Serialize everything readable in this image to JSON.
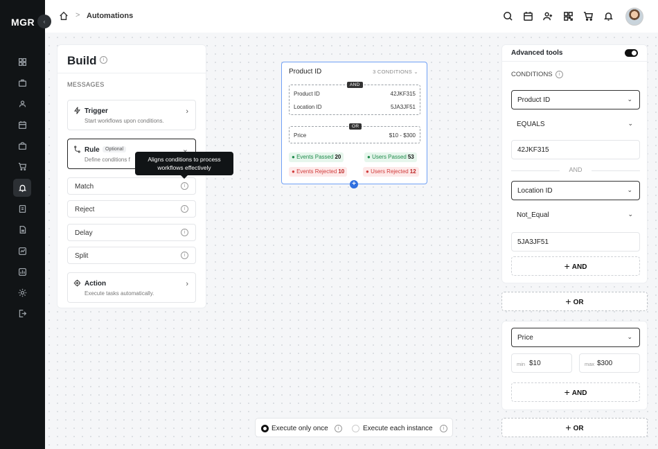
{
  "sidebar": {
    "logo": "MGR",
    "collapse_icon": "chevron-left-icon",
    "items": [
      "grid-icon",
      "briefcase-icon",
      "users-icon",
      "calendar-icon",
      "bag-icon",
      "cart-icon",
      "bell-icon",
      "file-icon",
      "document-icon",
      "chart-icon",
      "bar-chart-icon",
      "settings-icon",
      "logout-icon"
    ],
    "active_index": 6
  },
  "header": {
    "breadcrumb_separator": ">",
    "title": "Automations",
    "icons": [
      "search-icon",
      "calendar-icon",
      "user-plus-icon",
      "qr-icon",
      "cart-icon",
      "bell-icon"
    ]
  },
  "build": {
    "title": "Build",
    "section_label": "MESSAGES",
    "trigger": {
      "title": "Trigger",
      "subtitle": "Start workflows upon conditions."
    },
    "rule": {
      "title": "Rule",
      "badge": "Optional",
      "subtitle": "Define conditions f"
    },
    "tooltip": "Aligns conditions to process workflows effectively",
    "simple_items": [
      "Match",
      "Reject",
      "Delay",
      "Split"
    ],
    "action": {
      "title": "Action",
      "subtitle": "Execute tasks automatically."
    }
  },
  "node": {
    "title": "Product ID",
    "count": "3 CONDITIONS",
    "group1_op": "AND",
    "group1": [
      {
        "label": "Product ID",
        "value": "42JKF315"
      },
      {
        "label": "Location ID",
        "value": "5JA3JF51"
      }
    ],
    "group2_op": "OR",
    "group2": [
      {
        "label": "Price",
        "value": "$10 - $300"
      }
    ],
    "stats": {
      "events_passed_label": "Events Passed",
      "events_passed": "20",
      "users_passed_label": "Users Passed",
      "users_passed": "53",
      "events_rejected_label": "Events Rejected",
      "events_rejected": "10",
      "users_rejected_label": "Users Rejected",
      "users_rejected": "12"
    },
    "add_symbol": "+"
  },
  "execute": {
    "once_label": "Execute only once",
    "each_label": "Execute each instance",
    "selected": "once"
  },
  "advanced": {
    "title": "Advanced tools",
    "toggle_on": true,
    "conditions_label": "CONDITIONS",
    "field1": "Product ID",
    "op1": "EQUALS",
    "value1": "42JKF315",
    "and_sep": "AND",
    "field2": "Location ID",
    "op2": "Not_Equal",
    "value2": "5JA3JF51",
    "add_and": "AND",
    "or_label": "OR",
    "field3": "Price",
    "min_placeholder": "min",
    "min_value": "$10",
    "max_placeholder": "max",
    "max_value": "$300",
    "add_and2": "AND",
    "or_label2": "OR"
  },
  "colors": {
    "accent": "#2f6fdf",
    "sidebar": "#111416",
    "green": "#1e8a4a",
    "red": "#d13b3b"
  }
}
